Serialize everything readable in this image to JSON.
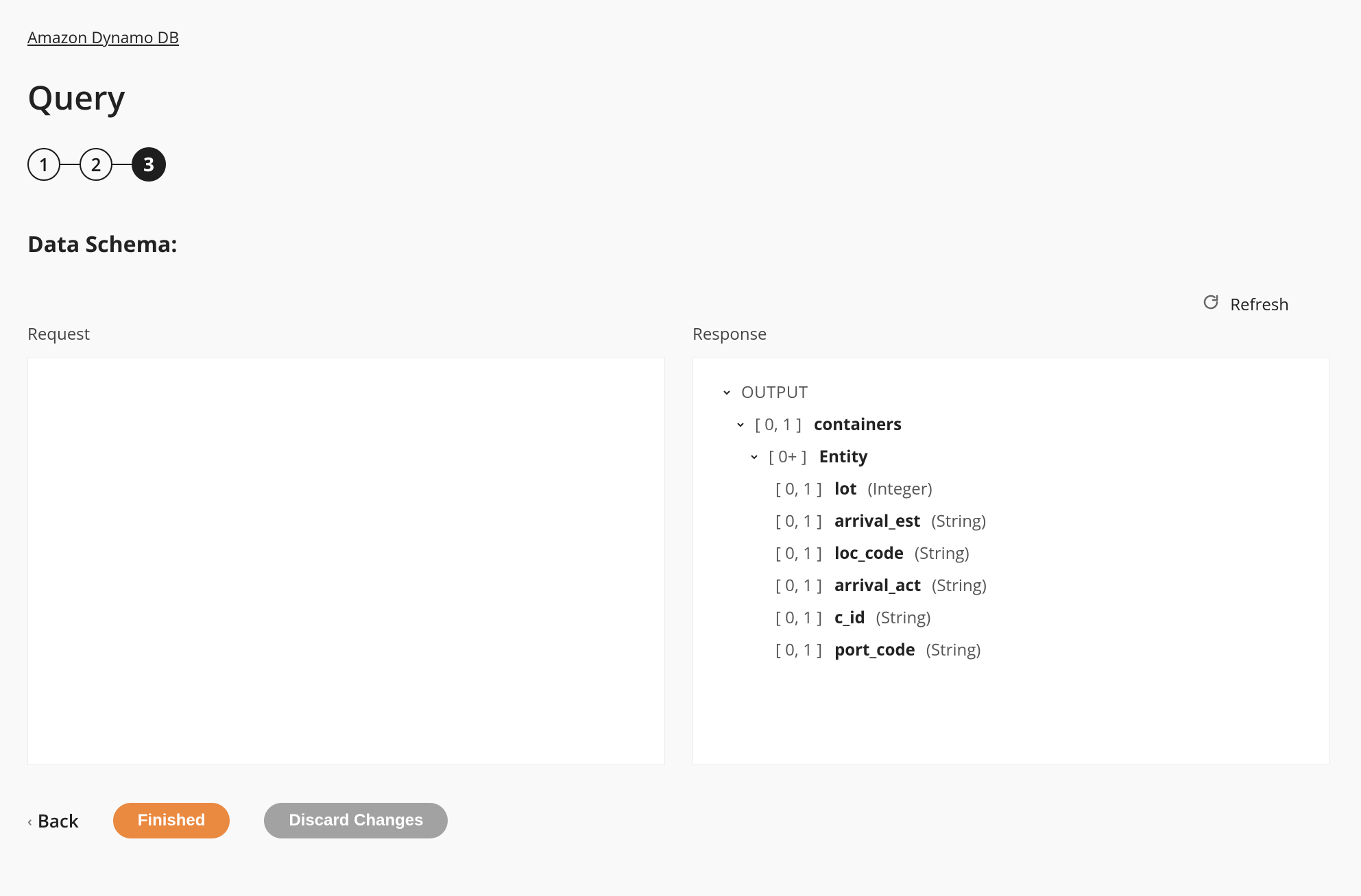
{
  "breadcrumb": "Amazon Dynamo DB",
  "page_title": "Query",
  "stepper": {
    "steps": [
      "1",
      "2",
      "3"
    ],
    "active_index": 2
  },
  "section_title": "Data Schema:",
  "refresh_label": "Refresh",
  "panels": {
    "request_label": "Request",
    "response_label": "Response"
  },
  "response_tree": {
    "root_label": "OUTPUT",
    "level1": {
      "cardinality": "[ 0, 1 ]",
      "name": "containers"
    },
    "level2": {
      "cardinality": "[ 0+ ]",
      "name": "Entity"
    },
    "fields": [
      {
        "cardinality": "[ 0, 1 ]",
        "name": "lot",
        "type": "(Integer)"
      },
      {
        "cardinality": "[ 0, 1 ]",
        "name": "arrival_est",
        "type": "(String)"
      },
      {
        "cardinality": "[ 0, 1 ]",
        "name": "loc_code",
        "type": "(String)"
      },
      {
        "cardinality": "[ 0, 1 ]",
        "name": "arrival_act",
        "type": "(String)"
      },
      {
        "cardinality": "[ 0, 1 ]",
        "name": "c_id",
        "type": "(String)"
      },
      {
        "cardinality": "[ 0, 1 ]",
        "name": "port_code",
        "type": "(String)"
      }
    ]
  },
  "footer": {
    "back": "Back",
    "finished": "Finished",
    "discard": "Discard Changes"
  }
}
